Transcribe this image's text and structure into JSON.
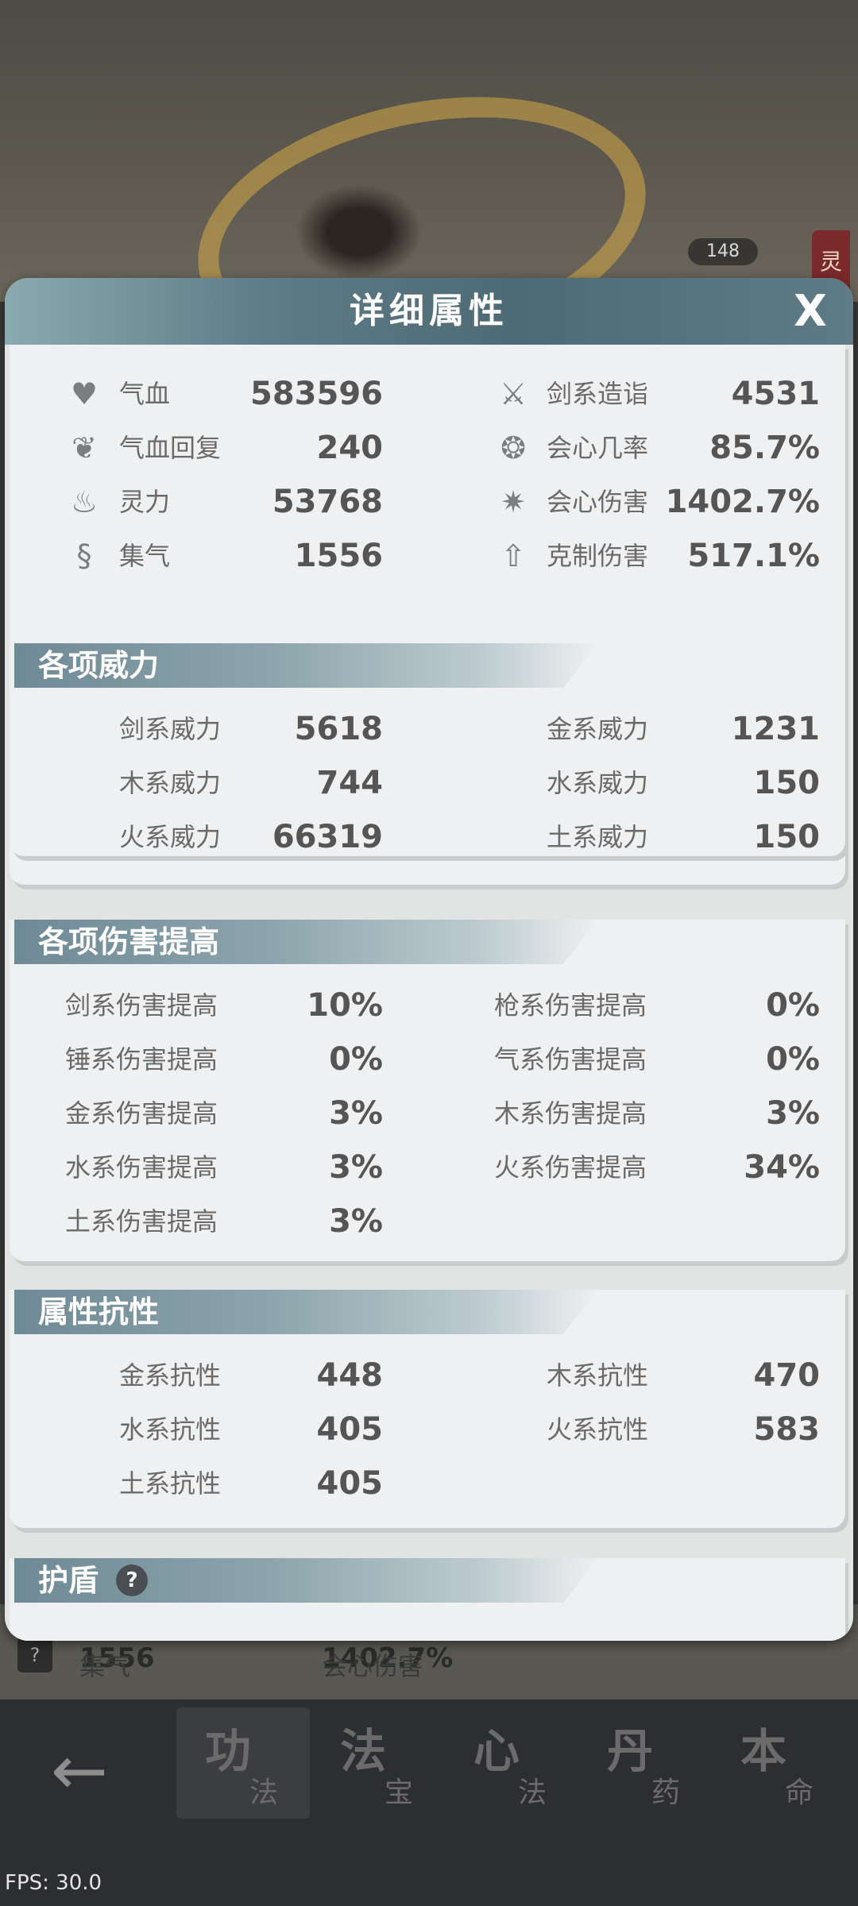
{
  "background": {
    "level": "148",
    "spirit_tag": "灵",
    "stats": [
      {
        "label": "集气",
        "value": "1556"
      },
      {
        "label": "会心伤害",
        "value": "1402.7%"
      }
    ]
  },
  "dialog": {
    "title": "详细属性",
    "close_label": "X"
  },
  "basic": {
    "left": [
      {
        "icon": "heart-icon",
        "label": "气血",
        "value": "583596"
      },
      {
        "icon": "heal-icon",
        "label": "气血回复",
        "value": "240"
      },
      {
        "icon": "flame-icon",
        "label": "灵力",
        "value": "53768"
      },
      {
        "icon": "swirl-icon",
        "label": "集气",
        "value": "1556"
      }
    ],
    "right": [
      {
        "icon": "sword-icon",
        "label": "剑系造诣",
        "value": "4531"
      },
      {
        "icon": "crit-rate-icon",
        "label": "会心几率",
        "value": "85.7%"
      },
      {
        "icon": "crit-damage-icon",
        "label": "会心伤害",
        "value": "1402.7%"
      },
      {
        "icon": "counter-icon",
        "label": "克制伤害",
        "value": "517.1%"
      }
    ]
  },
  "power": {
    "title": "各项威力",
    "left": [
      {
        "label": "剑系威力",
        "value": "5618"
      },
      {
        "label": "木系威力",
        "value": "744"
      },
      {
        "label": "火系威力",
        "value": "66319"
      }
    ],
    "right": [
      {
        "label": "金系威力",
        "value": "1231"
      },
      {
        "label": "水系威力",
        "value": "150"
      },
      {
        "label": "土系威力",
        "value": "150"
      }
    ]
  },
  "damage": {
    "title": "各项伤害提高",
    "left": [
      {
        "label": "剑系伤害提高",
        "value": "10%"
      },
      {
        "label": "锤系伤害提高",
        "value": "0%"
      },
      {
        "label": "金系伤害提高",
        "value": "3%"
      },
      {
        "label": "水系伤害提高",
        "value": "3%"
      },
      {
        "label": "土系伤害提高",
        "value": "3%"
      }
    ],
    "right": [
      {
        "label": "枪系伤害提高",
        "value": "0%"
      },
      {
        "label": "气系伤害提高",
        "value": "0%"
      },
      {
        "label": "木系伤害提高",
        "value": "3%"
      },
      {
        "label": "火系伤害提高",
        "value": "34%"
      }
    ]
  },
  "resist": {
    "title": "属性抗性",
    "left": [
      {
        "label": "金系抗性",
        "value": "448"
      },
      {
        "label": "水系抗性",
        "value": "405"
      },
      {
        "label": "土系抗性",
        "value": "405"
      }
    ],
    "right": [
      {
        "label": "木系抗性",
        "value": "470"
      },
      {
        "label": "火系抗性",
        "value": "583"
      }
    ]
  },
  "shield": {
    "title": "护盾",
    "help": "?"
  },
  "nav": {
    "back": "←",
    "tabs": [
      {
        "big": "功",
        "small": "法"
      },
      {
        "big": "法",
        "small": "宝"
      },
      {
        "big": "心",
        "small": "法"
      },
      {
        "big": "丹",
        "small": "药"
      },
      {
        "big": "本",
        "small": "命"
      }
    ]
  },
  "fps": "FPS: 30.0",
  "colors": {
    "header": "#5f7d87",
    "panel": "#eef0f1",
    "value_text": "#555555"
  }
}
